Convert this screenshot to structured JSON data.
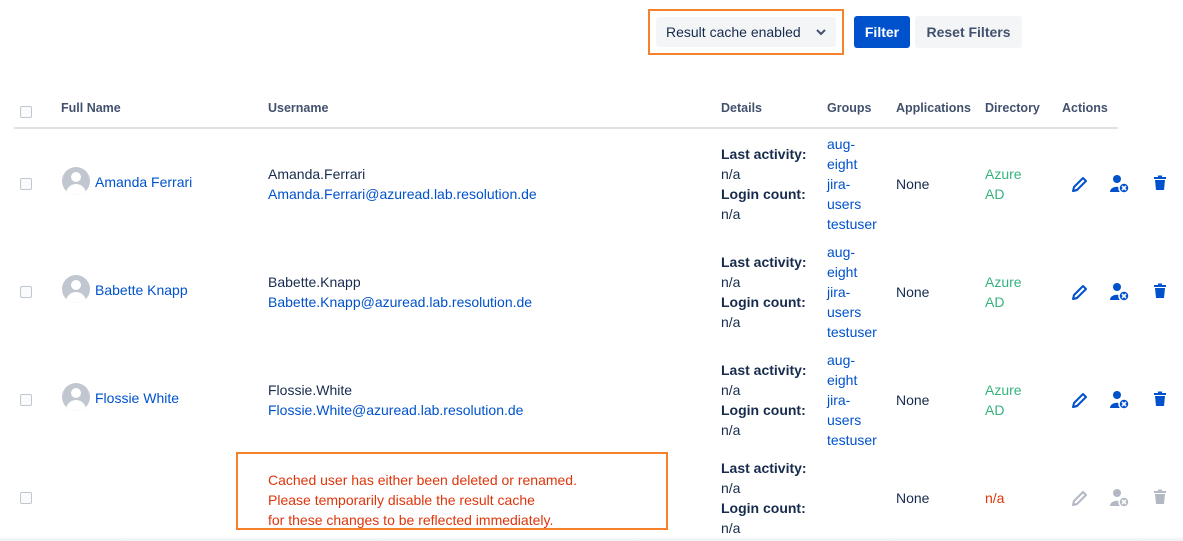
{
  "toolbar": {
    "cache_select": "Result cache enabled",
    "filter_label": "Filter",
    "reset_label": "Reset Filters"
  },
  "table": {
    "headers": [
      "Full Name",
      "Username",
      "Details",
      "Groups",
      "Applications",
      "Directory",
      "Actions"
    ],
    "rows": [
      {
        "full_name": "Amanda Ferrari",
        "username": "Amanda.Ferrari",
        "email": "Amanda.Ferrari@azuread.lab.resolution.de",
        "details": [
          "Last activity:",
          "n/a",
          "Login count:",
          "n/a"
        ],
        "groups": [
          "aug-",
          "eight",
          "jira-",
          "users",
          "testuser"
        ],
        "applications": "None",
        "directory": [
          "Azure",
          "AD"
        ]
      },
      {
        "full_name": "Babette Knapp",
        "username": "Babette.Knapp",
        "email": "Babette.Knapp@azuread.lab.resolution.de",
        "details": [
          "Last activity:",
          "n/a",
          "Login count:",
          "n/a"
        ],
        "groups": [
          "aug-",
          "eight",
          "jira-",
          "users",
          "testuser"
        ],
        "applications": "None",
        "directory": [
          "Azure",
          "AD"
        ]
      },
      {
        "full_name": "Flossie White",
        "username": "Flossie.White",
        "email": "Flossie.White@azuread.lab.resolution.de",
        "details": [
          "Last activity:",
          "n/a",
          "Login count:",
          "n/a"
        ],
        "groups": [
          "aug-",
          "eight",
          "jira-",
          "users",
          "testuser"
        ],
        "applications": "None",
        "directory": [
          "Azure",
          "AD"
        ]
      },
      {
        "warning": [
          "Cached user has either been deleted or renamed.",
          "Please temporarily disable the result cache",
          "for these changes to be reflected immediately."
        ],
        "details": [
          "Last activity:",
          "n/a",
          "Login count:",
          "n/a"
        ],
        "applications": "None",
        "directory": "n/a"
      }
    ]
  },
  "icons": {
    "edit": "pencil-icon",
    "user_remove": "user-remove-icon",
    "delete": "trash-icon",
    "avatar": "default-avatar-icon",
    "dropdown": "chevron-down-icon"
  },
  "colors": {
    "link": "#0052cc",
    "primary_button": "#0052cc",
    "directory_azure": "#36b37e",
    "error": "#de350b",
    "highlight": "#f5822b",
    "disabled_icon": "#b3b9c4"
  }
}
